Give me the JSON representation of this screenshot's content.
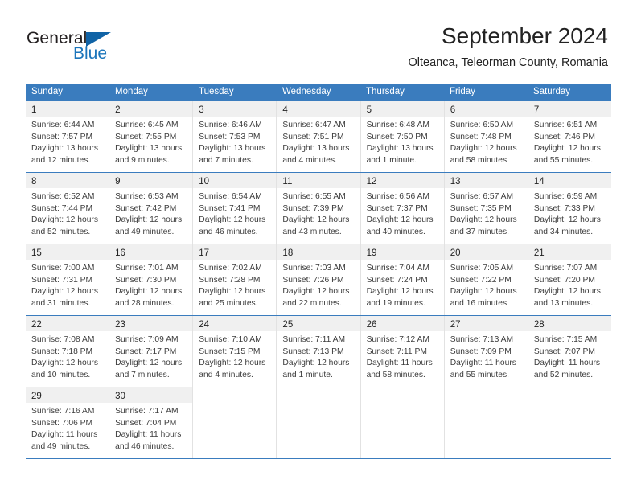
{
  "brand": {
    "name_part1": "General",
    "name_part2": "Blue",
    "triangle_color": "#1063a6",
    "blue_color": "#1b75bb",
    "dark_color": "#231f20"
  },
  "header": {
    "title": "September 2024",
    "subtitle": "Olteanca, Teleorman County, Romania"
  },
  "theme": {
    "header_bg": "#3a7cbe",
    "header_text": "#ffffff",
    "day_band_bg": "#f0f0f0",
    "cell_bg": "#ffffff",
    "grid_line": "#e2e2e2",
    "text": "#3d3d3d"
  },
  "weekdays": [
    "Sunday",
    "Monday",
    "Tuesday",
    "Wednesday",
    "Thursday",
    "Friday",
    "Saturday"
  ],
  "weeks": [
    [
      {
        "day": "1",
        "sunrise": "Sunrise: 6:44 AM",
        "sunset": "Sunset: 7:57 PM",
        "daylight1": "Daylight: 13 hours",
        "daylight2": "and 12 minutes."
      },
      {
        "day": "2",
        "sunrise": "Sunrise: 6:45 AM",
        "sunset": "Sunset: 7:55 PM",
        "daylight1": "Daylight: 13 hours",
        "daylight2": "and 9 minutes."
      },
      {
        "day": "3",
        "sunrise": "Sunrise: 6:46 AM",
        "sunset": "Sunset: 7:53 PM",
        "daylight1": "Daylight: 13 hours",
        "daylight2": "and 7 minutes."
      },
      {
        "day": "4",
        "sunrise": "Sunrise: 6:47 AM",
        "sunset": "Sunset: 7:51 PM",
        "daylight1": "Daylight: 13 hours",
        "daylight2": "and 4 minutes."
      },
      {
        "day": "5",
        "sunrise": "Sunrise: 6:48 AM",
        "sunset": "Sunset: 7:50 PM",
        "daylight1": "Daylight: 13 hours",
        "daylight2": "and 1 minute."
      },
      {
        "day": "6",
        "sunrise": "Sunrise: 6:50 AM",
        "sunset": "Sunset: 7:48 PM",
        "daylight1": "Daylight: 12 hours",
        "daylight2": "and 58 minutes."
      },
      {
        "day": "7",
        "sunrise": "Sunrise: 6:51 AM",
        "sunset": "Sunset: 7:46 PM",
        "daylight1": "Daylight: 12 hours",
        "daylight2": "and 55 minutes."
      }
    ],
    [
      {
        "day": "8",
        "sunrise": "Sunrise: 6:52 AM",
        "sunset": "Sunset: 7:44 PM",
        "daylight1": "Daylight: 12 hours",
        "daylight2": "and 52 minutes."
      },
      {
        "day": "9",
        "sunrise": "Sunrise: 6:53 AM",
        "sunset": "Sunset: 7:42 PM",
        "daylight1": "Daylight: 12 hours",
        "daylight2": "and 49 minutes."
      },
      {
        "day": "10",
        "sunrise": "Sunrise: 6:54 AM",
        "sunset": "Sunset: 7:41 PM",
        "daylight1": "Daylight: 12 hours",
        "daylight2": "and 46 minutes."
      },
      {
        "day": "11",
        "sunrise": "Sunrise: 6:55 AM",
        "sunset": "Sunset: 7:39 PM",
        "daylight1": "Daylight: 12 hours",
        "daylight2": "and 43 minutes."
      },
      {
        "day": "12",
        "sunrise": "Sunrise: 6:56 AM",
        "sunset": "Sunset: 7:37 PM",
        "daylight1": "Daylight: 12 hours",
        "daylight2": "and 40 minutes."
      },
      {
        "day": "13",
        "sunrise": "Sunrise: 6:57 AM",
        "sunset": "Sunset: 7:35 PM",
        "daylight1": "Daylight: 12 hours",
        "daylight2": "and 37 minutes."
      },
      {
        "day": "14",
        "sunrise": "Sunrise: 6:59 AM",
        "sunset": "Sunset: 7:33 PM",
        "daylight1": "Daylight: 12 hours",
        "daylight2": "and 34 minutes."
      }
    ],
    [
      {
        "day": "15",
        "sunrise": "Sunrise: 7:00 AM",
        "sunset": "Sunset: 7:31 PM",
        "daylight1": "Daylight: 12 hours",
        "daylight2": "and 31 minutes."
      },
      {
        "day": "16",
        "sunrise": "Sunrise: 7:01 AM",
        "sunset": "Sunset: 7:30 PM",
        "daylight1": "Daylight: 12 hours",
        "daylight2": "and 28 minutes."
      },
      {
        "day": "17",
        "sunrise": "Sunrise: 7:02 AM",
        "sunset": "Sunset: 7:28 PM",
        "daylight1": "Daylight: 12 hours",
        "daylight2": "and 25 minutes."
      },
      {
        "day": "18",
        "sunrise": "Sunrise: 7:03 AM",
        "sunset": "Sunset: 7:26 PM",
        "daylight1": "Daylight: 12 hours",
        "daylight2": "and 22 minutes."
      },
      {
        "day": "19",
        "sunrise": "Sunrise: 7:04 AM",
        "sunset": "Sunset: 7:24 PM",
        "daylight1": "Daylight: 12 hours",
        "daylight2": "and 19 minutes."
      },
      {
        "day": "20",
        "sunrise": "Sunrise: 7:05 AM",
        "sunset": "Sunset: 7:22 PM",
        "daylight1": "Daylight: 12 hours",
        "daylight2": "and 16 minutes."
      },
      {
        "day": "21",
        "sunrise": "Sunrise: 7:07 AM",
        "sunset": "Sunset: 7:20 PM",
        "daylight1": "Daylight: 12 hours",
        "daylight2": "and 13 minutes."
      }
    ],
    [
      {
        "day": "22",
        "sunrise": "Sunrise: 7:08 AM",
        "sunset": "Sunset: 7:18 PM",
        "daylight1": "Daylight: 12 hours",
        "daylight2": "and 10 minutes."
      },
      {
        "day": "23",
        "sunrise": "Sunrise: 7:09 AM",
        "sunset": "Sunset: 7:17 PM",
        "daylight1": "Daylight: 12 hours",
        "daylight2": "and 7 minutes."
      },
      {
        "day": "24",
        "sunrise": "Sunrise: 7:10 AM",
        "sunset": "Sunset: 7:15 PM",
        "daylight1": "Daylight: 12 hours",
        "daylight2": "and 4 minutes."
      },
      {
        "day": "25",
        "sunrise": "Sunrise: 7:11 AM",
        "sunset": "Sunset: 7:13 PM",
        "daylight1": "Daylight: 12 hours",
        "daylight2": "and 1 minute."
      },
      {
        "day": "26",
        "sunrise": "Sunrise: 7:12 AM",
        "sunset": "Sunset: 7:11 PM",
        "daylight1": "Daylight: 11 hours",
        "daylight2": "and 58 minutes."
      },
      {
        "day": "27",
        "sunrise": "Sunrise: 7:13 AM",
        "sunset": "Sunset: 7:09 PM",
        "daylight1": "Daylight: 11 hours",
        "daylight2": "and 55 minutes."
      },
      {
        "day": "28",
        "sunrise": "Sunrise: 7:15 AM",
        "sunset": "Sunset: 7:07 PM",
        "daylight1": "Daylight: 11 hours",
        "daylight2": "and 52 minutes."
      }
    ],
    [
      {
        "day": "29",
        "sunrise": "Sunrise: 7:16 AM",
        "sunset": "Sunset: 7:06 PM",
        "daylight1": "Daylight: 11 hours",
        "daylight2": "and 49 minutes."
      },
      {
        "day": "30",
        "sunrise": "Sunrise: 7:17 AM",
        "sunset": "Sunset: 7:04 PM",
        "daylight1": "Daylight: 11 hours",
        "daylight2": "and 46 minutes."
      },
      {
        "day": "",
        "sunrise": "",
        "sunset": "",
        "daylight1": "",
        "daylight2": ""
      },
      {
        "day": "",
        "sunrise": "",
        "sunset": "",
        "daylight1": "",
        "daylight2": ""
      },
      {
        "day": "",
        "sunrise": "",
        "sunset": "",
        "daylight1": "",
        "daylight2": ""
      },
      {
        "day": "",
        "sunrise": "",
        "sunset": "",
        "daylight1": "",
        "daylight2": ""
      },
      {
        "day": "",
        "sunrise": "",
        "sunset": "",
        "daylight1": "",
        "daylight2": ""
      }
    ]
  ]
}
